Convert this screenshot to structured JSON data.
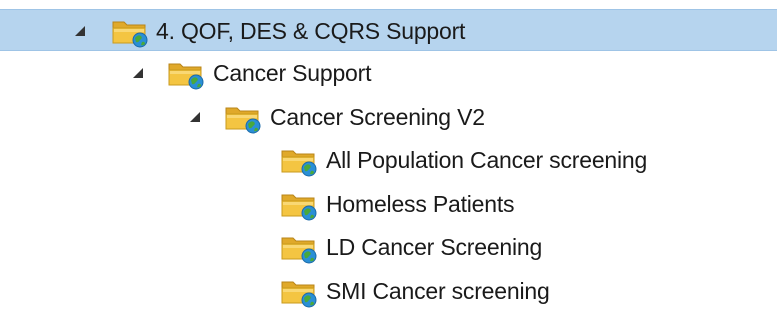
{
  "tree": {
    "nodes": [
      {
        "label": "4. QOF, DES & CQRS Support",
        "expanded": true,
        "selected": true,
        "icon": "folder-globe-icon"
      },
      {
        "label": "Cancer Support",
        "expanded": true,
        "selected": false,
        "icon": "folder-globe-icon"
      },
      {
        "label": "Cancer Screening V2",
        "expanded": true,
        "selected": false,
        "icon": "folder-globe-icon"
      },
      {
        "label": "All Population Cancer screening",
        "expanded": null,
        "selected": false,
        "icon": "folder-globe-icon"
      },
      {
        "label": "Homeless Patients",
        "expanded": null,
        "selected": false,
        "icon": "folder-globe-icon"
      },
      {
        "label": "LD Cancer Screening",
        "expanded": null,
        "selected": false,
        "icon": "folder-globe-icon"
      },
      {
        "label": "SMI Cancer screening",
        "expanded": null,
        "selected": false,
        "icon": "folder-globe-icon"
      }
    ]
  },
  "colors": {
    "selection_bg": "#b6d4ee",
    "folder_yellow": "#f4c542",
    "globe_blue": "#2a8fd6",
    "globe_green": "#49a83c"
  }
}
